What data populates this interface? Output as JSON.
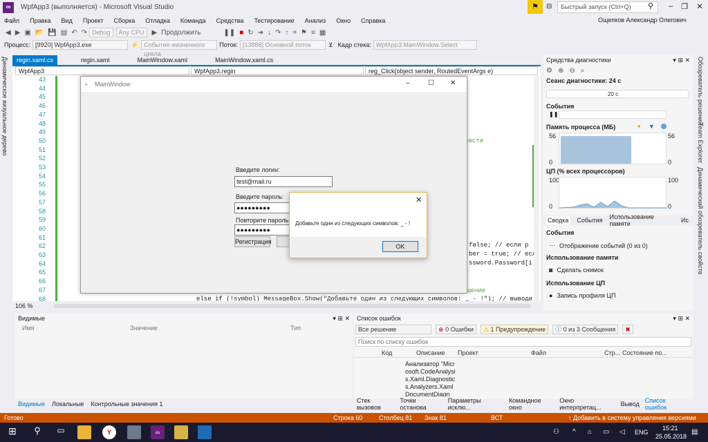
{
  "window": {
    "title": "WpfApp3 (выполняется) - Microsoft Visual Studio",
    "quick_launch_placeholder": "Быстрый запуск (Ctrl+Q)",
    "user": "Ощепков Александр Олегович"
  },
  "menu": [
    "Файл",
    "Правка",
    "Вид",
    "Проект",
    "Сборка",
    "Отладка",
    "Команда",
    "Средства",
    "Тестирование",
    "Анализ",
    "Окно",
    "Справка"
  ],
  "toolbar": {
    "config": "Debug",
    "platform": "Any CPU",
    "continue_label": "Продолжить"
  },
  "process_bar": {
    "process_label": "Процесс:",
    "process_value": "[9920] WpfApp3.exe",
    "lifecycle": "События жизненного цикла",
    "thread_label": "Поток:",
    "thread_value": "[13888] Основной поток",
    "stack_label": "Кадр стека:",
    "stack_value": "WpfApp3.MainWindow.Select"
  },
  "left_strip": "Динамическое визуальное дерево",
  "editor": {
    "tabs": [
      "regin.xaml.cs",
      "regin.xaml",
      "MainWindow.xaml",
      "MainWindow.xaml.cs"
    ],
    "nav": [
      "WpfApp3",
      "WpfApp3.regin",
      "reg_Click(object sender, RoutedEventArgs e)"
    ],
    "line_numbers": [
      "43",
      "44",
      "45",
      "46",
      "47",
      "48",
      "49",
      "50",
      "51",
      "52",
      "53",
      "54",
      "55",
      "56",
      "57",
      "58",
      "59",
      "60",
      "61",
      "62",
      "63",
      "64",
      "65",
      "66",
      "67",
      "68"
    ],
    "code_fragments": [
      "части",
      "false; // если р",
      "ber = true; // есл",
      "ssword.Password[i",
      "// выводим сообщение",
      "else if (!symbol) MessageBox.Show(\"Добавьте один из следующих символов: _ - !\"); // выводи"
    ],
    "zoom": "106 %"
  },
  "app": {
    "title": "MainWindow",
    "login_label": "Введите логин:",
    "login_value": "test@mail.ru",
    "password_label": "Введите пароль:",
    "password_value": "●●●●●●●●●",
    "repeat_label": "Повторите пароль:",
    "repeat_value": "●●●●●●●●●",
    "register_button": "Регистрация"
  },
  "dialog": {
    "message": "Добавьте один из следующих символов: _ - !",
    "ok": "OK"
  },
  "diagnostics": {
    "title": "Средства диагностики",
    "session": "Сеанс диагностики: 24 с",
    "time_tick": "20 с",
    "events_label": "События",
    "memory_label": "Память процесса (МБ)",
    "memory_max": "56",
    "memory_min": "0",
    "cpu_label": "ЦП (% всех процессоров)",
    "cpu_max": "100",
    "cpu_min": "0",
    "tabs": [
      "Сводка",
      "События",
      "Использование памяти",
      "Ис"
    ],
    "events_section": "События",
    "events_item": "Отображение событий (0 из 0)",
    "memory_section": "Использование памяти",
    "memory_item": "Сделать снимок",
    "cpu_section": "Использование ЦП",
    "cpu_item": "Запись профиля ЦП"
  },
  "right_strip": [
    "Обозреватель решений",
    "Team Explorer",
    "Динамический обозреватель свойств"
  ],
  "locals": {
    "title": "Видимые",
    "columns": [
      "Имя",
      "Значение",
      "Тип"
    ],
    "tabs": [
      "Видимые",
      "Локальные",
      "Контрольные значения 1"
    ]
  },
  "errors": {
    "title": "Список ошибок",
    "scope": "Все решение",
    "errors_btn": "0 Ошибки",
    "warnings_btn": "1 Предупреждение",
    "messages_btn": "0 из 3 Сообщения",
    "search_placeholder": "Поиск по списку ошибок",
    "columns": [
      "Код",
      "Описание",
      "Проект",
      "Файл",
      "Стр...",
      "Состояние по..."
    ],
    "row_desc": "Анализатор \"Microsoft.CodeAnalysis.Xaml.Diagnostics.Analyzers.XamlDocumentDiagn",
    "tabs": [
      "Стек вызовов",
      "Точки останова",
      "Параметры исклю...",
      "Командное окно",
      "Окно интерпретац...",
      "Вывод",
      "Список ошибок"
    ]
  },
  "status": {
    "ready": "Готово",
    "row": "Строка 60",
    "col": "Столбец 81",
    "char": "Знак 81",
    "ins": "ВСТ",
    "vcs": "Добавить в систему управления версиями"
  },
  "taskbar": {
    "lang": "ENG",
    "time": "15:21",
    "date": "25.05.2018"
  },
  "colors": {
    "accent": "#007acc",
    "status": "#ca5100",
    "vs_purple": "#68217a"
  }
}
